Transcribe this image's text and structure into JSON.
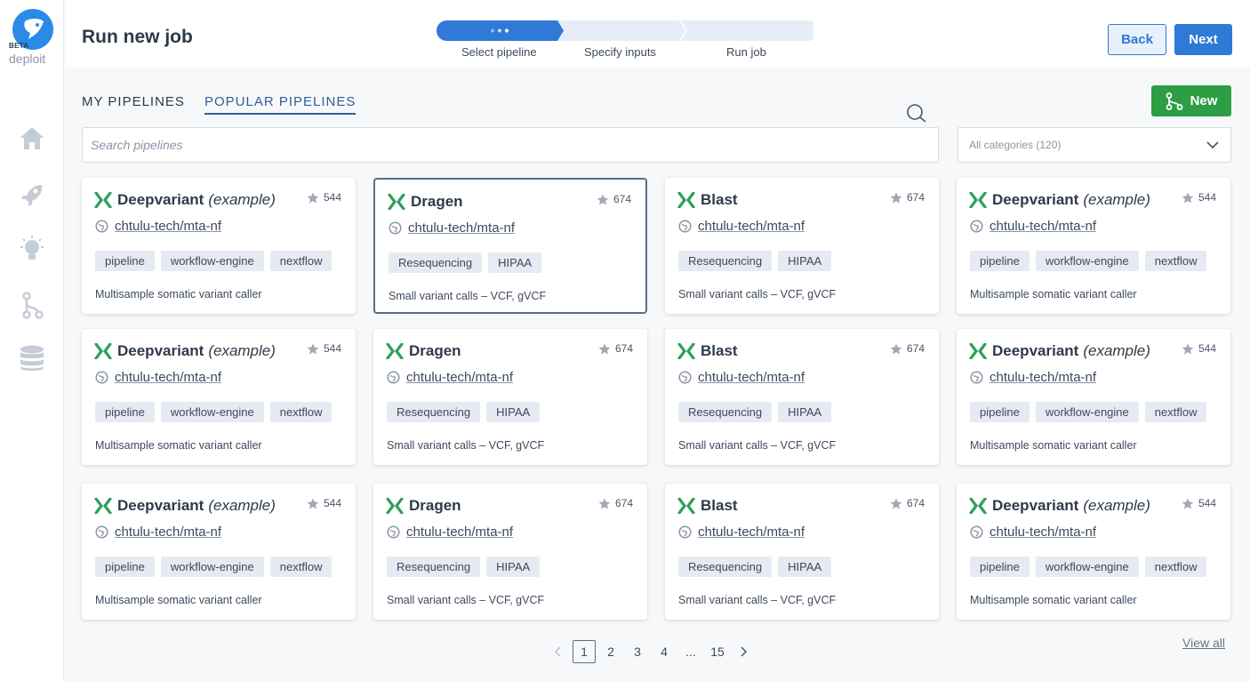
{
  "app": {
    "logo_text": "deploit",
    "beta_badge": "BETA",
    "page_title": "Run new job"
  },
  "stepper": {
    "steps": [
      {
        "label": "Select pipeline",
        "state": "active"
      },
      {
        "label": "Specify inputs",
        "state": "pending"
      },
      {
        "label": "Run job",
        "state": "pending"
      }
    ]
  },
  "header_actions": {
    "back_label": "Back",
    "next_label": "Next"
  },
  "sidebar": {
    "items": [
      {
        "icon": "home-icon"
      },
      {
        "icon": "rocket-icon"
      },
      {
        "icon": "lightbulb-icon"
      },
      {
        "icon": "pipeline-branch-icon"
      },
      {
        "icon": "database-icon"
      }
    ]
  },
  "tabs": [
    {
      "label": "MY PIPELINES",
      "active": false
    },
    {
      "label": "POPULAR PIPELINES",
      "active": true
    }
  ],
  "new_button_label": "New",
  "search": {
    "placeholder": "Search pipelines",
    "value": ""
  },
  "category_filter": {
    "value": "All categories (120)"
  },
  "pipelines": [
    {
      "name": "Deepvariant",
      "suffix": "(example)",
      "stars": "544",
      "repo": "chtulu-tech/mta-nf",
      "tags": [
        "pipeline",
        "workflow-engine",
        "nextflow"
      ],
      "description": "Multisample somatic variant caller",
      "selected": false
    },
    {
      "name": "Dragen",
      "suffix": "",
      "stars": "674",
      "repo": "chtulu-tech/mta-nf",
      "tags": [
        "Resequencing",
        "HIPAA"
      ],
      "description": "Small variant calls – VCF, gVCF",
      "selected": true
    },
    {
      "name": "Blast",
      "suffix": "",
      "stars": "674",
      "repo": "chtulu-tech/mta-nf",
      "tags": [
        "Resequencing",
        "HIPAA"
      ],
      "description": "Small variant calls – VCF, gVCF",
      "selected": false
    },
    {
      "name": "Deepvariant",
      "suffix": "(example)",
      "stars": "544",
      "repo": "chtulu-tech/mta-nf",
      "tags": [
        "pipeline",
        "workflow-engine",
        "nextflow"
      ],
      "description": "Multisample somatic variant caller",
      "selected": false
    },
    {
      "name": "Deepvariant",
      "suffix": "(example)",
      "stars": "544",
      "repo": "chtulu-tech/mta-nf",
      "tags": [
        "pipeline",
        "workflow-engine",
        "nextflow"
      ],
      "description": "Multisample somatic variant caller",
      "selected": false
    },
    {
      "name": "Dragen",
      "suffix": "",
      "stars": "674",
      "repo": "chtulu-tech/mta-nf",
      "tags": [
        "Resequencing",
        "HIPAA"
      ],
      "description": "Small variant calls – VCF, gVCF",
      "selected": false
    },
    {
      "name": "Blast",
      "suffix": "",
      "stars": "674",
      "repo": "chtulu-tech/mta-nf",
      "tags": [
        "Resequencing",
        "HIPAA"
      ],
      "description": "Small variant calls – VCF, gVCF",
      "selected": false
    },
    {
      "name": "Deepvariant",
      "suffix": "(example)",
      "stars": "544",
      "repo": "chtulu-tech/mta-nf",
      "tags": [
        "pipeline",
        "workflow-engine",
        "nextflow"
      ],
      "description": "Multisample somatic variant caller",
      "selected": false
    },
    {
      "name": "Deepvariant",
      "suffix": "(example)",
      "stars": "544",
      "repo": "chtulu-tech/mta-nf",
      "tags": [
        "pipeline",
        "workflow-engine",
        "nextflow"
      ],
      "description": "Multisample somatic variant caller",
      "selected": false
    },
    {
      "name": "Dragen",
      "suffix": "",
      "stars": "674",
      "repo": "chtulu-tech/mta-nf",
      "tags": [
        "Resequencing",
        "HIPAA"
      ],
      "description": "Small variant calls – VCF, gVCF",
      "selected": false
    },
    {
      "name": "Blast",
      "suffix": "",
      "stars": "674",
      "repo": "chtulu-tech/mta-nf",
      "tags": [
        "Resequencing",
        "HIPAA"
      ],
      "description": "Small variant calls – VCF, gVCF",
      "selected": false
    },
    {
      "name": "Deepvariant",
      "suffix": "(example)",
      "stars": "544",
      "repo": "chtulu-tech/mta-nf",
      "tags": [
        "pipeline",
        "workflow-engine",
        "nextflow"
      ],
      "description": "Multisample somatic variant caller",
      "selected": false
    }
  ],
  "pagination": {
    "pages": [
      "1",
      "2",
      "3",
      "4",
      "...",
      "15"
    ],
    "current": "1"
  },
  "view_all_label": "View all",
  "colors": {
    "primary": "#2f7ad6",
    "success": "#2e9e44",
    "pipeline_icon": "#2ea05a",
    "sidebar_icon": "#c5ccd6"
  }
}
